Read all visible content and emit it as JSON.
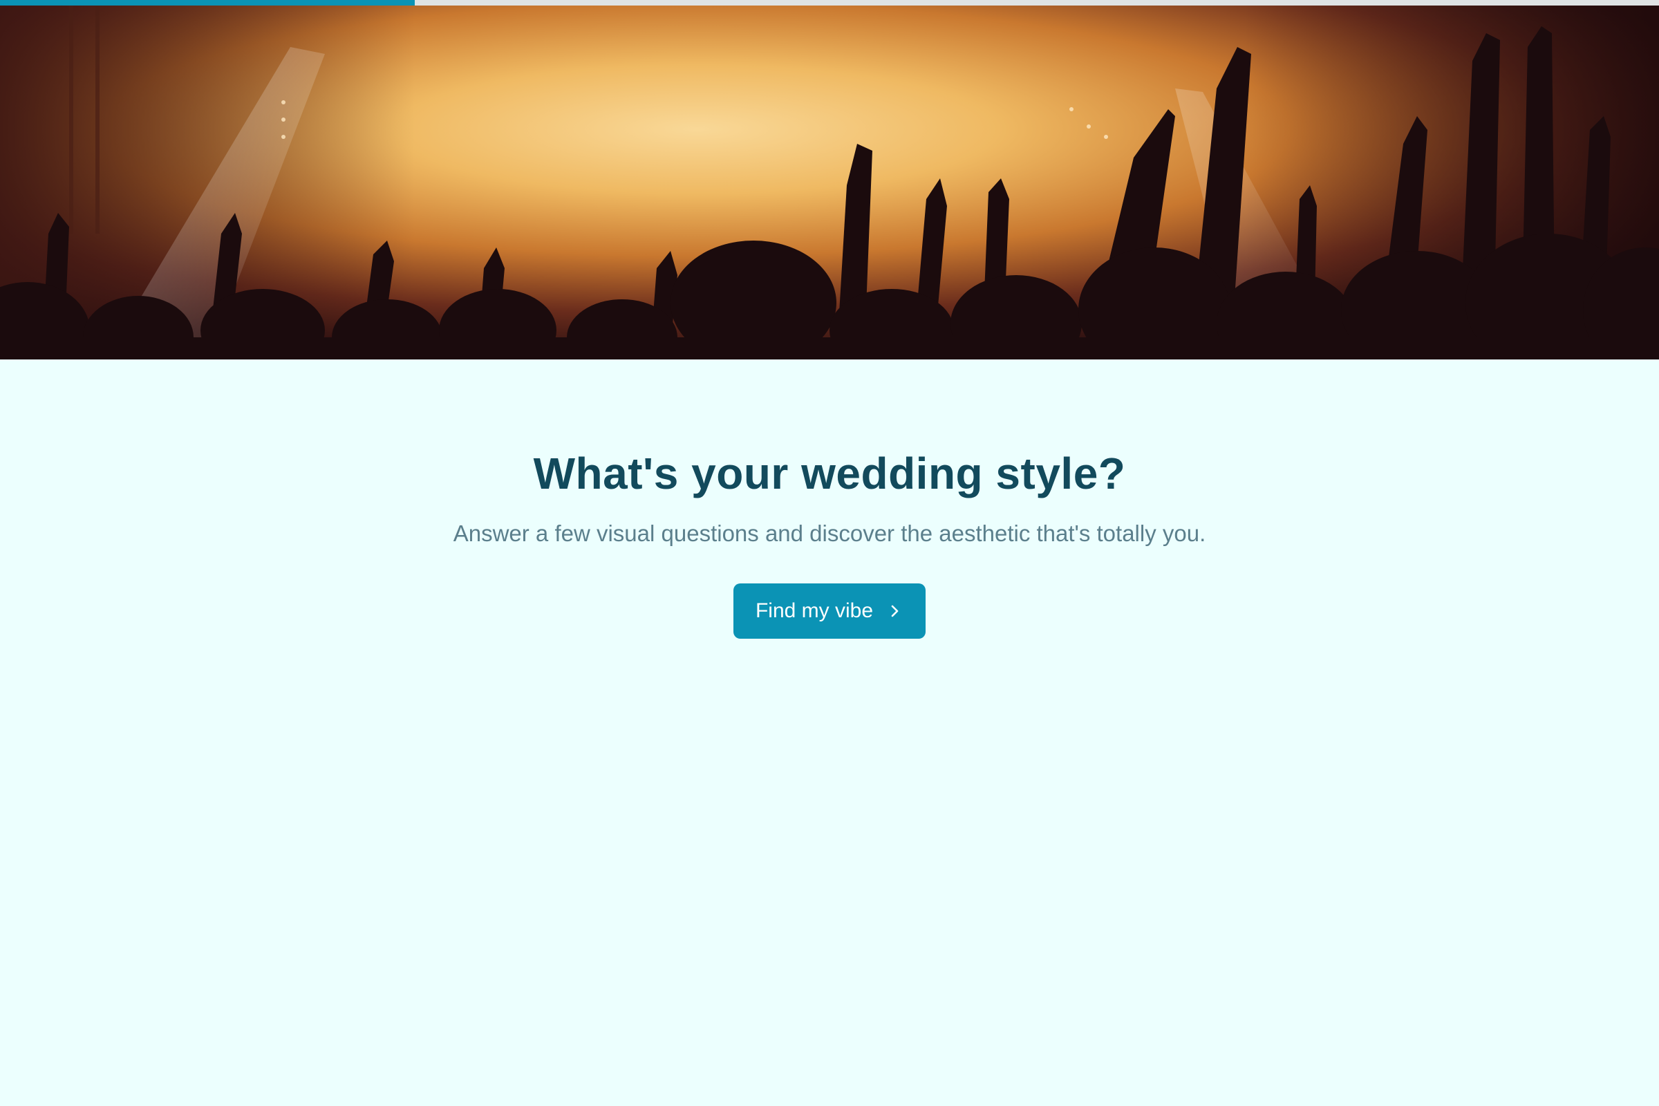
{
  "progress": {
    "fraction": 0.25,
    "track_color": "#dfe3e4",
    "fill_color": "#0b93b5"
  },
  "hero": {
    "description_icon": "concert-crowd-photo"
  },
  "intro": {
    "title": "What's your wedding style?",
    "subtitle": "Answer a few visual questions and discover the aesthetic that's totally you.",
    "cta_label": "Find my vibe",
    "cta_icon": "chevron-right-icon"
  },
  "colors": {
    "background": "#ecfffe",
    "title": "#124a5c",
    "subtitle": "#5b7f8c",
    "accent": "#0b93b5"
  }
}
